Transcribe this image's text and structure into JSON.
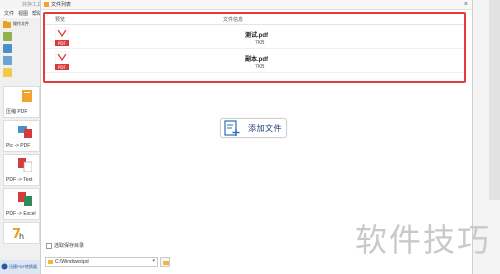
{
  "app": {
    "title": "转换工具",
    "menu": [
      "文件",
      "视图",
      "帮助"
    ],
    "first_item": "操作文件",
    "bottom_text": "迅捷PDF转换器"
  },
  "tools": [
    {
      "label": "压缩 PDF",
      "icon": "compress-pdf-icon"
    },
    {
      "label": "Pic -> PDF",
      "icon": "pic-to-pdf-icon"
    },
    {
      "label": "PDF -> Text",
      "icon": "pdf-to-text-icon"
    },
    {
      "label": "PDF -> Excel",
      "icon": "pdf-to-excel-icon"
    },
    {
      "label": "",
      "icon": "ocr-icon"
    }
  ],
  "dialog": {
    "title": "文件列表",
    "columns": {
      "preview": "预览",
      "filename": "文件信息"
    },
    "files": [
      {
        "name": "测试.pdf",
        "size": "7KB",
        "icon": "pdf-icon"
      },
      {
        "name": "副本.pdf",
        "size": "7KB",
        "icon": "pdf-icon"
      }
    ],
    "add_button": "添加文件",
    "save_label": "选取保存目录",
    "save_path": "C:\\Windows\\pd",
    "accent": "#e53b3b"
  },
  "watermark": "软件技巧"
}
